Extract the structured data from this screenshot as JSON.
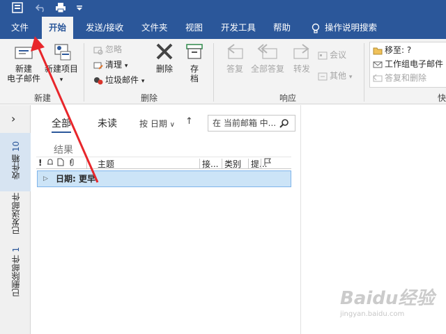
{
  "qat": {
    "icons": [
      "outlook-icon",
      "undo-icon",
      "print-icon",
      "customize-qat-icon"
    ]
  },
  "tabs": [
    {
      "label": "文件"
    },
    {
      "label": "开始"
    },
    {
      "label": "发送/接收"
    },
    {
      "label": "文件夹"
    },
    {
      "label": "视图"
    },
    {
      "label": "开发工具"
    },
    {
      "label": "帮助"
    },
    {
      "label": "操作说明搜索"
    }
  ],
  "active_tab": "开始",
  "ribbon": {
    "new_group": {
      "label": "新建",
      "new_email": "新建\n电子邮件",
      "new_item": "新建项目"
    },
    "delete_group": {
      "label": "删除",
      "ignore": "忽略",
      "cleanup": "清理",
      "junk": "垃圾邮件",
      "delete": "删除",
      "archive": "存\n档"
    },
    "respond_group": {
      "label": "响应",
      "reply": "答复",
      "reply_all": "全部答复",
      "forward": "转发",
      "meeting": "会议",
      "more": "其他"
    },
    "quick_group": {
      "label": "快",
      "move_to": "移至: ?",
      "team_email": "工作组电子邮件",
      "reply_delete": "答复和删除"
    }
  },
  "nav": {
    "expand_glyph": "›",
    "inbox": {
      "label": "收件箱",
      "count": "10"
    },
    "sent": {
      "label": "已发送邮件"
    },
    "deleted": {
      "label": "已删除邮件",
      "count": "1"
    }
  },
  "list": {
    "filter_all": "全部",
    "filter_unread": "未读",
    "sort_by": "按 日期",
    "sort_arrow": "↑",
    "search_placeholder": "在 当前邮箱 中...",
    "results_label": "结果",
    "columns": [
      "!",
      "主题",
      "接...",
      "类别",
      "提..."
    ],
    "group_row": "日期: 更早"
  },
  "watermark": {
    "main": "Baidu经验",
    "sub": "jingyan.baidu.com"
  },
  "colors": {
    "accent": "#2b579a",
    "ribbon_bg": "#f3f3f3",
    "selected_row": "#cce4f7",
    "annotation_arrow": "#e8262b"
  }
}
